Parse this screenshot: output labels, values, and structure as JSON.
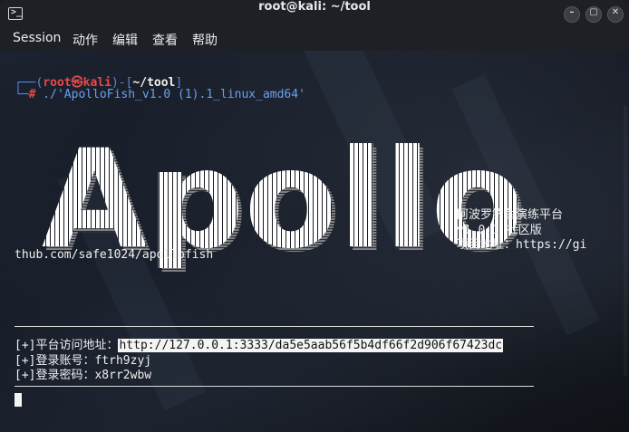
{
  "window": {
    "title": "root@kali: ~/tool",
    "icon": "terminal-icon",
    "buttons": {
      "minimize": "minimize-icon",
      "maximize": "maximize-icon",
      "close": "close-icon"
    }
  },
  "menu": [
    "Session",
    "动作",
    "编辑",
    "查看",
    "帮助"
  ],
  "prompt": {
    "open": "┌──(",
    "user": "root㉿kali",
    "mid": ")-[",
    "path": "~/tool",
    "close": "]",
    "line2_prefix": "└─",
    "hash": "#",
    "command": " ./'ApolloFish_v1.0 (1).1_linux_amd64'"
  },
  "banner": {
    "logo_text": "Apollo",
    "info_lines": [
      "阿波罗钓鱼演练平台",
      "v1.0.1 社区版",
      "项目地址：https://gi"
    ],
    "url_left": "thub.com/safe1024/apollofish"
  },
  "output": {
    "platform_label": "[+]平台访问地址：",
    "platform_url": "http://127.0.0.1:3333/da5e5aab56f5b4df66f2d906f67423dc",
    "account_line": "[+]登录账号：ftrh9zyj",
    "password_line": "[+]登录密码：x8rr2wbw"
  }
}
